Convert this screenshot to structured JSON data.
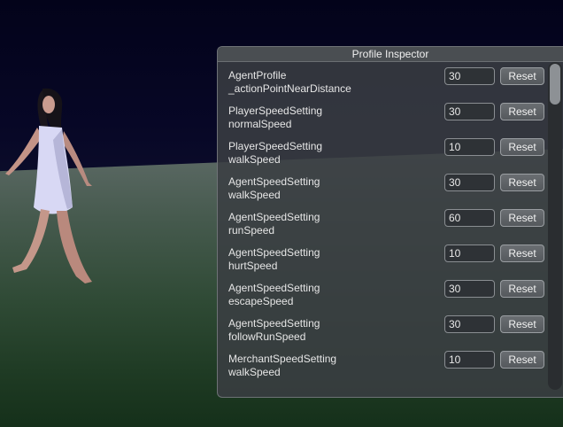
{
  "panel": {
    "title": "Profile Inspector",
    "reset_label": "Reset",
    "rows": [
      {
        "line1": "AgentProfile",
        "line2": "_actionPointNearDistance",
        "value": "30"
      },
      {
        "line1": "PlayerSpeedSetting",
        "line2": "normalSpeed",
        "value": "30"
      },
      {
        "line1": "PlayerSpeedSetting",
        "line2": "walkSpeed",
        "value": "10"
      },
      {
        "line1": "AgentSpeedSetting",
        "line2": "walkSpeed",
        "value": "30"
      },
      {
        "line1": "AgentSpeedSetting",
        "line2": "runSpeed",
        "value": "60"
      },
      {
        "line1": "AgentSpeedSetting",
        "line2": "hurtSpeed",
        "value": "10"
      },
      {
        "line1": "AgentSpeedSetting",
        "line2": "escapeSpeed",
        "value": "30"
      },
      {
        "line1": "AgentSpeedSetting",
        "line2": "followRunSpeed",
        "value": "30"
      },
      {
        "line1": "MerchantSpeedSetting",
        "line2": "walkSpeed",
        "value": "10"
      }
    ],
    "scroll_position": 0.0
  },
  "colors": {
    "sky": "#03031a",
    "ground": "#2f4a35",
    "panel_bg": "#3a3e42",
    "field_bg": "#2e3236",
    "button_bg": "#5f6367"
  }
}
